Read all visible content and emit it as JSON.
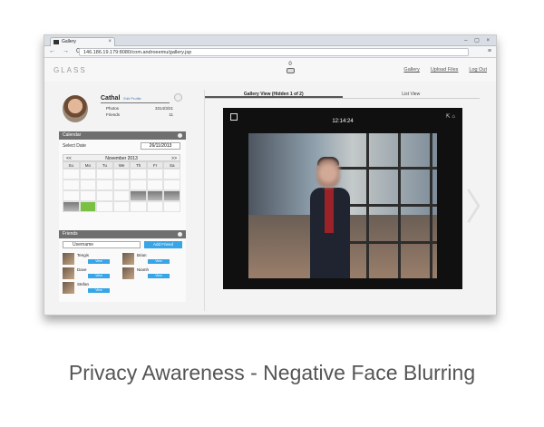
{
  "browser": {
    "tab_title": "Gallery",
    "tab_close": "×",
    "window_controls": "– ▢ ×",
    "nav": "← → C",
    "url": "146.186.19.179:8080/com.androeemu/gallery.jsp",
    "menu": "≡"
  },
  "app": {
    "logo": "GLASS",
    "glass_count": "0",
    "topnav": [
      "Gallery",
      "Upload Files",
      "Log Out"
    ]
  },
  "profile": {
    "name": "Cathal",
    "edit": "Edit Profile",
    "photos_label": "Photos",
    "photos_value": "3314/3/21",
    "friends_label": "Friends",
    "friends_value": "11"
  },
  "calendar": {
    "title": "Calendar",
    "select_label": "Select Date",
    "select_value": "26/11/2013",
    "month": "November 2013",
    "prev": "<<",
    "next": ">>",
    "dow": [
      "Su",
      "Mo",
      "Tu",
      "We",
      "Th",
      "Fr",
      "Sa"
    ]
  },
  "friends": {
    "title": "Friends",
    "search_value": "Username",
    "add_button": "Add Friend",
    "list": [
      {
        "name": "Tengis",
        "button": "View"
      },
      {
        "name": "Brian",
        "button": "View"
      },
      {
        "name": "Dave",
        "button": "View"
      },
      {
        "name": "Niamh",
        "button": "View"
      },
      {
        "name": "Stefan",
        "button": "View"
      }
    ]
  },
  "viewer": {
    "tabs": [
      "Gallery View (Hidden 1 of 2)",
      "List View"
    ],
    "time": "12:14:24",
    "left_arrow": "〈",
    "right_arrow": "〉"
  },
  "caption": "Privacy Awareness - Negative Face Blurring"
}
